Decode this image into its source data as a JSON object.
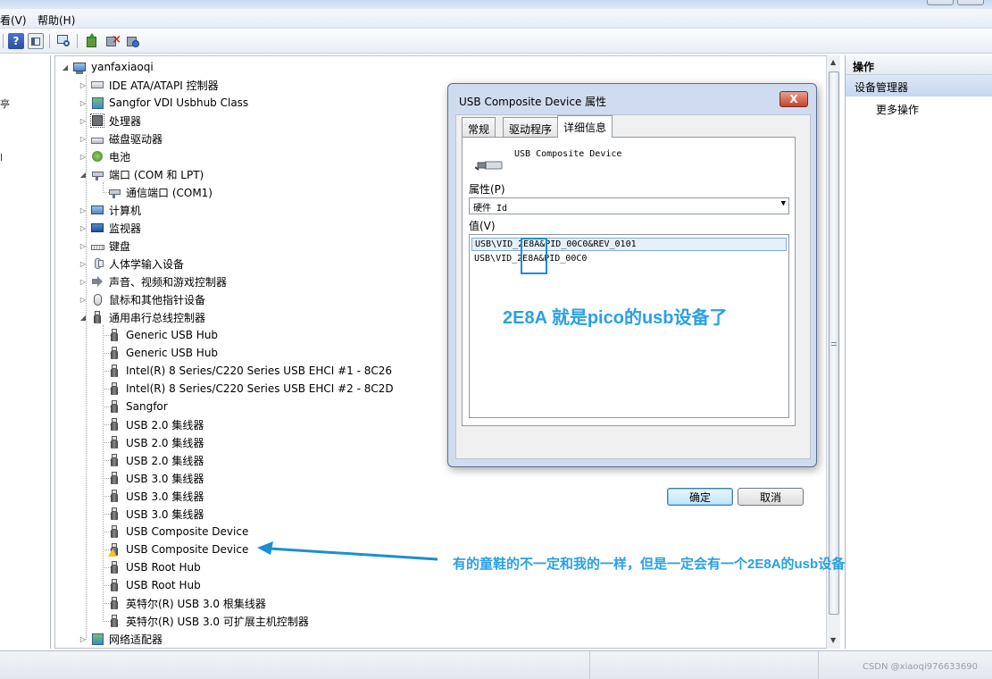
{
  "menu": {
    "view": "看(V)",
    "help": "帮助(H)"
  },
  "tree": {
    "root": "yanfaxiaoqi",
    "ide": "IDE ATA/ATAPI 控制器",
    "sangfor_hub": "Sangfor VDI Usbhub Class",
    "cpu": "处理器",
    "disk": "磁盘驱动器",
    "battery": "电池",
    "ports": "端口 (COM 和 LPT)",
    "com1": "通信端口 (COM1)",
    "computer": "计算机",
    "monitor": "监视器",
    "keyboard": "键盘",
    "hid": "人体学输入设备",
    "sound": "声音、视频和游戏控制器",
    "mouse": "鼠标和其他指针设备",
    "usb_ctrl": "通用串行总线控制器",
    "usb_children": [
      "Generic USB Hub",
      "Generic USB Hub",
      "Intel(R) 8 Series/C220 Series USB EHCI #1 - 8C26",
      "Intel(R) 8 Series/C220 Series USB EHCI #2 - 8C2D",
      "Sangfor",
      "USB 2.0 集线器",
      "USB 2.0 集线器",
      "USB 2.0 集线器",
      "USB 3.0 集线器",
      "USB 3.0 集线器",
      "USB 3.0 集线器",
      "USB Composite Device",
      "USB Composite Device",
      "USB Root Hub",
      "USB Root Hub",
      "英特尔(R) USB 3.0 根集线器",
      "英特尔(R) USB 3.0 可扩展主机控制器"
    ],
    "network": "网络适配器"
  },
  "actions": {
    "header": "操作",
    "section": "设备管理器",
    "more": "更多操作"
  },
  "dialog": {
    "title": "USB Composite Device 属性",
    "close": "X",
    "tabs": [
      "常规",
      "驱动程序",
      "详细信息"
    ],
    "device_name": "USB Composite Device",
    "property_label": "属性(P)",
    "property_value": "硬件 Id",
    "value_label": "值(V)",
    "values": [
      "USB\\VID_2E8A&PID_00C0&REV_0101",
      "USB\\VID_2E8A&PID_00C0"
    ],
    "ok": "确定",
    "cancel": "取消"
  },
  "annotations": {
    "dialog_note": "2E8A 就是pico的usb设备了",
    "arrow_note": "有的童鞋的不一定和我的一样，但是一定会有一个2E8A的usb设备"
  },
  "watermark": "CSDN @xiaoqi976633690",
  "colors": {
    "annotation": "#29a0e6",
    "selection": "#e6f0fb"
  }
}
